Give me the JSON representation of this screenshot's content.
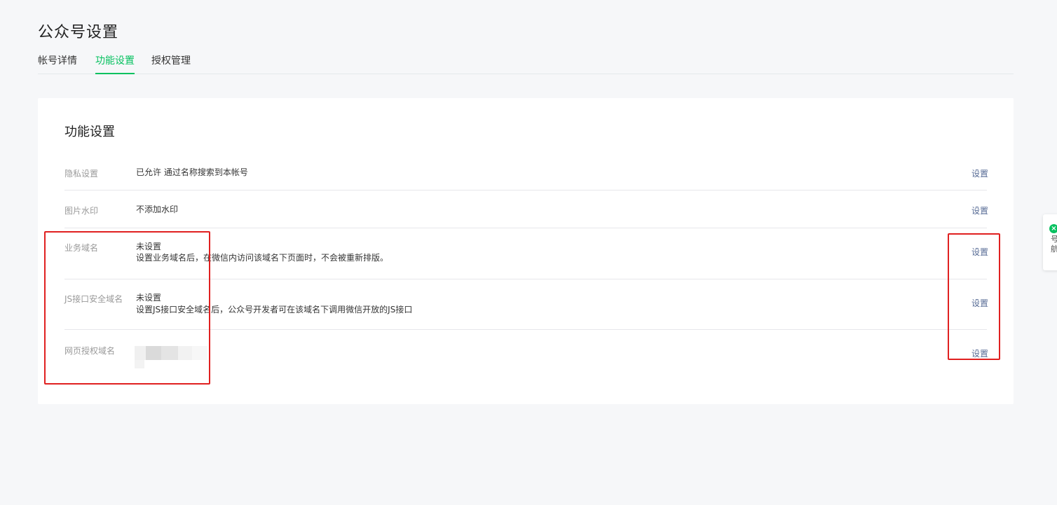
{
  "page": {
    "title": "公众号设置"
  },
  "tabs": [
    {
      "label": "帐号详情",
      "active": false
    },
    {
      "label": "功能设置",
      "active": true
    },
    {
      "label": "授权管理",
      "active": false
    }
  ],
  "panel": {
    "title": "功能设置",
    "rows": [
      {
        "label": "隐私设置",
        "value": "已允许 通过名称搜索到本帐号",
        "desc": "",
        "action": "设置"
      },
      {
        "label": "图片水印",
        "value": "不添加水印",
        "desc": "",
        "action": "设置"
      },
      {
        "label": "业务域名",
        "value": "未设置",
        "desc": "设置业务域名后，在微信内访问该域名下页面时，不会被重新排版。",
        "action": "设置"
      },
      {
        "label": "JS接口安全域名",
        "value": "未设置",
        "desc": "设置JS接口安全域名后，公众号开发者可在该域名下调用微信开放的JS接口",
        "action": "设置"
      },
      {
        "label": "网页授权域名",
        "value": "",
        "desc": "",
        "action": "设置"
      }
    ]
  },
  "float_widget": {
    "text": "号航"
  },
  "colors": {
    "accent": "#07c160",
    "link": "#576b95",
    "highlight": "#e02020"
  }
}
